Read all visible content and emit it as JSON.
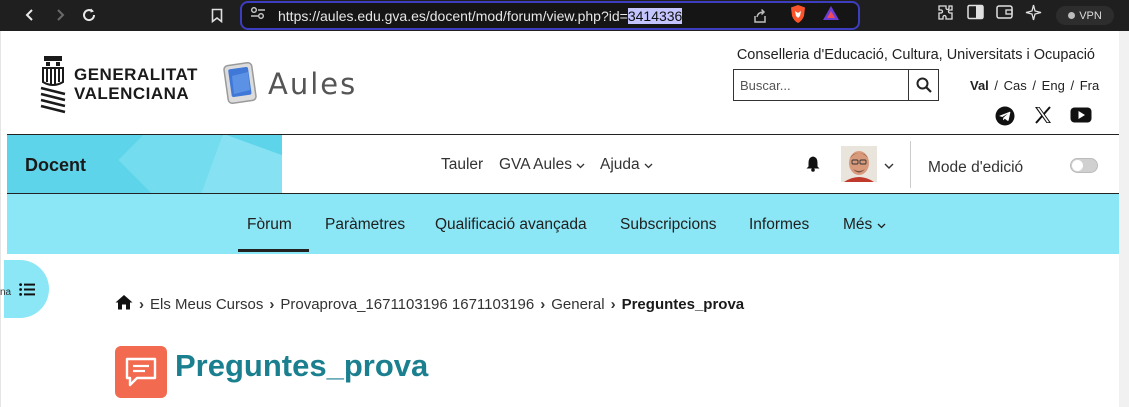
{
  "browser": {
    "url_prefix": "https://aules.edu.gva.es/docent/mod/forum/view.php?id=",
    "url_selected": "3414336",
    "vpn_label": "VPN"
  },
  "header": {
    "gva_line1": "GENERALITAT",
    "gva_line2": "VALENCIANA",
    "aules_name": "Aules",
    "conselleria": "Conselleria d'Educació, Cultura, Universitats i Ocupació",
    "search_placeholder": "Buscar...",
    "languages": [
      {
        "label": "Val",
        "active": true
      },
      {
        "label": "Cas",
        "active": false
      },
      {
        "label": "Eng",
        "active": false
      },
      {
        "label": "Fra",
        "active": false
      }
    ],
    "lang_sep": "/"
  },
  "topnav": {
    "site": "Docent",
    "items": [
      "Tauler",
      "GVA Aules",
      "Ajuda"
    ],
    "edit_mode": "Mode d'edició"
  },
  "secnav": {
    "items": [
      "Fòrum",
      "Paràmetres",
      "Qualificació avançada",
      "Subscripcions",
      "Informes",
      "Més"
    ],
    "active": "Fòrum"
  },
  "left_edge_text": "na",
  "breadcrumb": [
    "Els Meus Cursos",
    "Provaprova_1671103196 1671103196",
    "General",
    "Preguntes_prova"
  ],
  "page_title": "Preguntes_prova",
  "colors": {
    "accent_cyan": "#8be6f5",
    "docent_box": "#5ed4ea",
    "title": "#1a7f8f",
    "forum_icon": "#f26b50"
  }
}
